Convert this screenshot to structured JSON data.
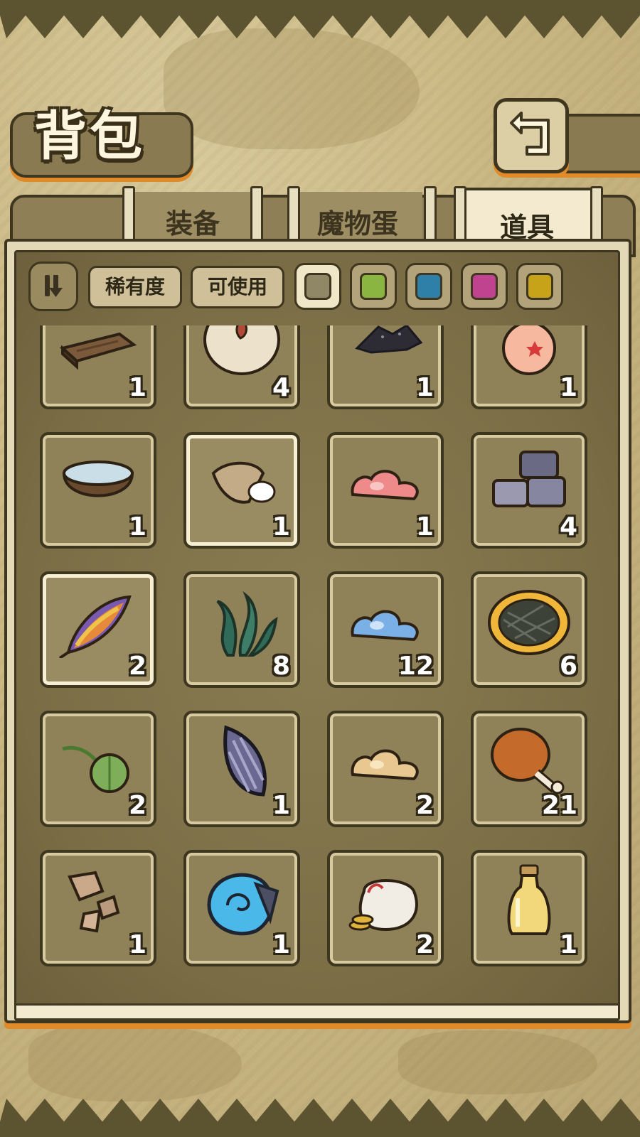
{
  "header": {
    "title": "背包"
  },
  "tabs": [
    {
      "label": "装备",
      "active": false
    },
    {
      "label": "魔物蛋",
      "active": false
    },
    {
      "label": "道具",
      "active": true
    }
  ],
  "filters": {
    "rarity_label": "稀有度",
    "usable_label": "可使用",
    "rarity_colors": [
      "#8f8766",
      "#8ab541",
      "#2f80a8",
      "#c0438f",
      "#c7a31a"
    ]
  },
  "items": [
    {
      "icon": "wooden-plank-icon",
      "qty": "1"
    },
    {
      "icon": "monster-egg-icon",
      "qty": "4"
    },
    {
      "icon": "black-powder-icon",
      "qty": "1"
    },
    {
      "icon": "peach-icon",
      "qty": "1"
    },
    {
      "icon": "water-bowl-icon",
      "qty": "1"
    },
    {
      "icon": "rice-sack-icon",
      "qty": "1"
    },
    {
      "icon": "pink-slime-icon",
      "qty": "1"
    },
    {
      "icon": "stone-blocks-icon",
      "qty": "4"
    },
    {
      "icon": "rainbow-feather-icon",
      "qty": "2"
    },
    {
      "icon": "seaweed-icon",
      "qty": "8"
    },
    {
      "icon": "blue-slime-icon",
      "qty": "12"
    },
    {
      "icon": "pie-icon",
      "qty": "6"
    },
    {
      "icon": "green-seed-icon",
      "qty": "2"
    },
    {
      "icon": "purple-seed-icon",
      "qty": "1"
    },
    {
      "icon": "yellow-slime-icon",
      "qty": "2"
    },
    {
      "icon": "roast-drumstick-icon",
      "qty": "21"
    },
    {
      "icon": "rock-fragments-icon",
      "qty": "1"
    },
    {
      "icon": "blue-shell-icon",
      "qty": "1"
    },
    {
      "icon": "coin-bag-icon",
      "qty": "2"
    },
    {
      "icon": "oil-bottle-icon",
      "qty": "1"
    }
  ]
}
